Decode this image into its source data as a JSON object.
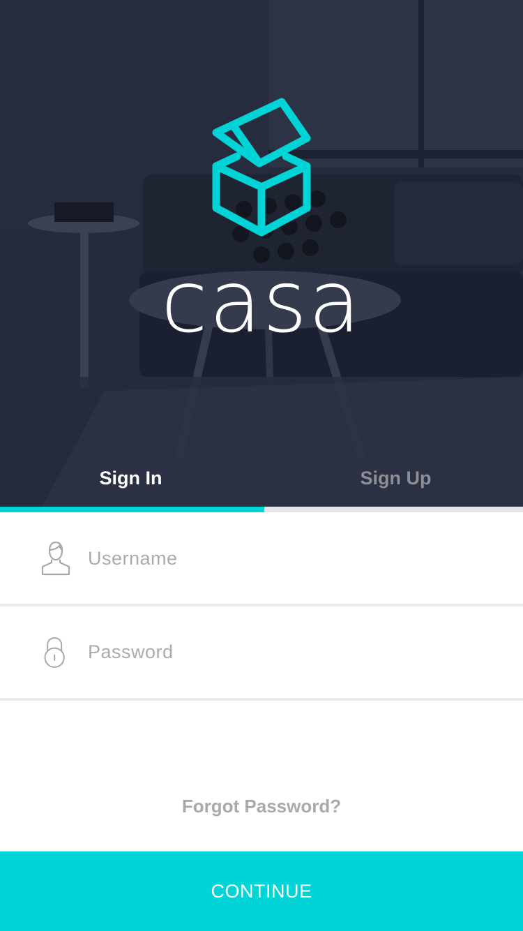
{
  "brand": {
    "name": "casa",
    "logo_icon": "open-box-icon"
  },
  "tabs": [
    {
      "label": "Sign In",
      "active": true
    },
    {
      "label": "Sign Up",
      "active": false
    }
  ],
  "tab_indicator_progress": 0.5,
  "form": {
    "username": {
      "placeholder": "Username",
      "value": "",
      "icon": "user-icon"
    },
    "password": {
      "placeholder": "Password",
      "value": "",
      "icon": "lock-icon"
    }
  },
  "forgot_label": "Forgot Password?",
  "continue_label": "CONTINUE",
  "colors": {
    "accent": "#00d4d6",
    "hero_overlay": "#262c3d",
    "tab_active_text": "#ffffff",
    "tab_inactive_text": "#8d8f96",
    "muted_text": "#a9a9a9",
    "divider": "#ececec"
  }
}
